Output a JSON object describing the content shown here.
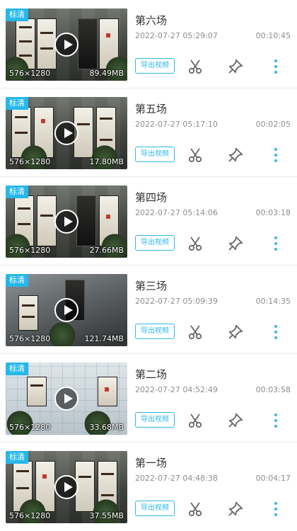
{
  "videos": [
    {
      "badge": "标清",
      "title": "第六场",
      "date": "2022-07-27 05:29:07",
      "duration": "00:10:45",
      "resolution": "576×1280",
      "size": "89.49MB",
      "export_label": "导出视频",
      "style": "dark"
    },
    {
      "badge": "标清",
      "title": "第五场",
      "date": "2022-07-27 05:17:10",
      "duration": "00:02:05",
      "resolution": "576×1280",
      "size": "17.80MB",
      "export_label": "导出视频",
      "style": "dark"
    },
    {
      "badge": "标清",
      "title": "第四场",
      "date": "2022-07-27 05:14:06",
      "duration": "00:03:18",
      "resolution": "576×1280",
      "size": "27.66MB",
      "export_label": "导出视频",
      "style": "dark"
    },
    {
      "badge": "标清",
      "title": "第三场",
      "date": "2022-07-27 05:09:39",
      "duration": "00:14:35",
      "resolution": "576×1280",
      "size": "121.74MB",
      "export_label": "导出视频",
      "style": "dark"
    },
    {
      "badge": "标清",
      "title": "第二场",
      "date": "2022-07-27 04:52:49",
      "duration": "00:03:58",
      "resolution": "576×1280",
      "size": "33.68MB",
      "export_label": "导出视频",
      "style": "light"
    },
    {
      "badge": "标清",
      "title": "第一场",
      "date": "2022-07-27 04:48:38",
      "duration": "00:04:17",
      "resolution": "576×1280",
      "size": "37.55MB",
      "export_label": "导出视频",
      "style": "dark"
    }
  ],
  "icons": {
    "scissors": "scissors-icon",
    "pin": "pushpin-icon",
    "more": "more-vertical-icon"
  },
  "colors": {
    "accent": "#2fb8ea",
    "badge": "#26b7e9",
    "text": "#333333",
    "muted": "#8d8d8d"
  }
}
